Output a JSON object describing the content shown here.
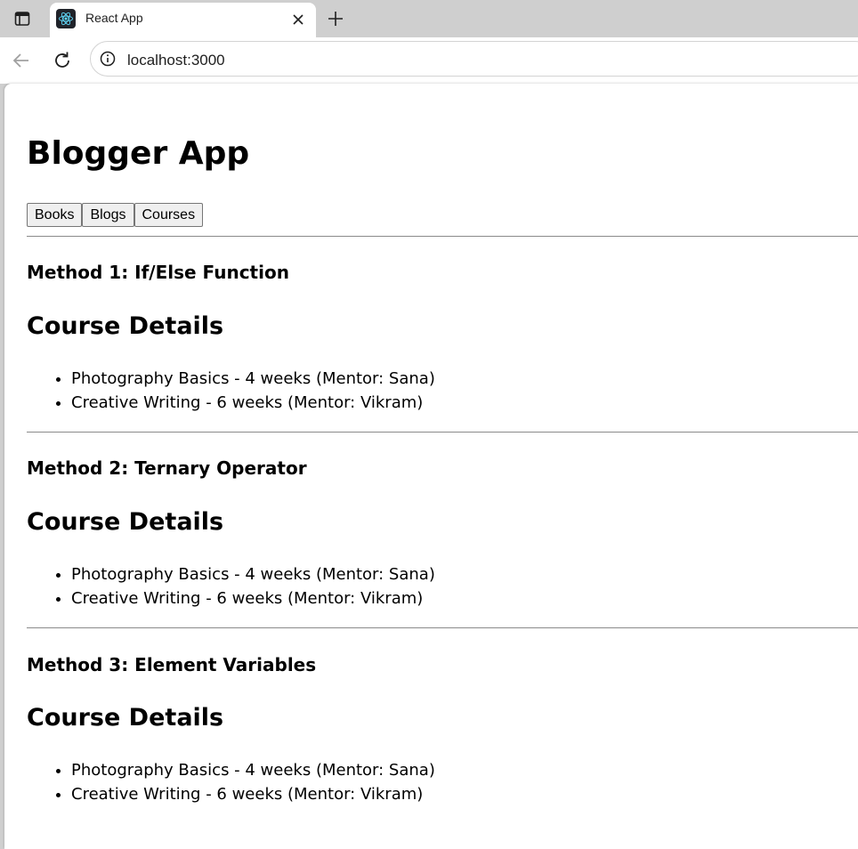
{
  "browser": {
    "tab_title": "React App",
    "url": "localhost:3000",
    "icons": {
      "tab_actions": "tab-actions-icon",
      "favicon": "react-logo-icon",
      "close": "close-icon",
      "new_tab": "plus-icon",
      "back": "back-arrow-icon",
      "reload": "reload-icon",
      "site_info": "info-icon"
    }
  },
  "page": {
    "title": "Blogger App",
    "buttons": [
      "Books",
      "Blogs",
      "Courses"
    ],
    "sections": [
      {
        "method": "Method 1: If/Else Function",
        "heading": "Course Details",
        "items": [
          "Photography Basics - 4 weeks (Mentor: Sana)",
          "Creative Writing - 6 weeks (Mentor: Vikram)"
        ]
      },
      {
        "method": "Method 2: Ternary Operator",
        "heading": "Course Details",
        "items": [
          "Photography Basics - 4 weeks (Mentor: Sana)",
          "Creative Writing - 6 weeks (Mentor: Vikram)"
        ]
      },
      {
        "method": "Method 3: Element Variables",
        "heading": "Course Details",
        "items": [
          "Photography Basics - 4 weeks (Mentor: Sana)",
          "Creative Writing - 6 weeks (Mentor: Vikram)"
        ]
      }
    ]
  }
}
